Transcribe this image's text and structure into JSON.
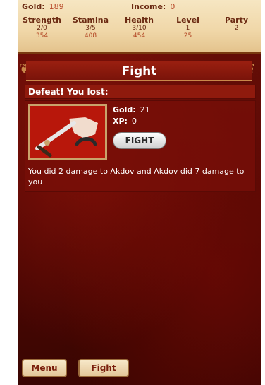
{
  "top": {
    "gold_label": "Gold:",
    "gold_value": "189",
    "income_label": "Income:",
    "income_value": "0"
  },
  "stats": [
    {
      "label": "Strength",
      "v1": "2/0",
      "v2": "354"
    },
    {
      "label": "Stamina",
      "v1": "3/5",
      "v2": "408"
    },
    {
      "label": "Health",
      "v1": "3/10",
      "v2": "454"
    },
    {
      "label": "Level",
      "v1": "1",
      "v2": "25"
    },
    {
      "label": "Party",
      "v1": "2",
      "v2": ""
    }
  ],
  "title": "Fight",
  "result": "Defeat! You lost:",
  "panel": {
    "gold_label": "Gold:",
    "gold_value": "21",
    "xp_label": "XP:",
    "xp_value": "0",
    "fight_button": "FIGHT",
    "message": "You did 2 damage to Akdov and Akdov did 7 damage to you"
  },
  "bottom": {
    "menu": "Menu",
    "fight": "Fight"
  },
  "colors": {
    "parchment": "#f0d7a8",
    "blood_red": "#8f1a0d",
    "text_brown": "#6b2a12"
  },
  "icons": {
    "art": "sword-and-hand-icon",
    "swirl": "ornament-icon"
  }
}
